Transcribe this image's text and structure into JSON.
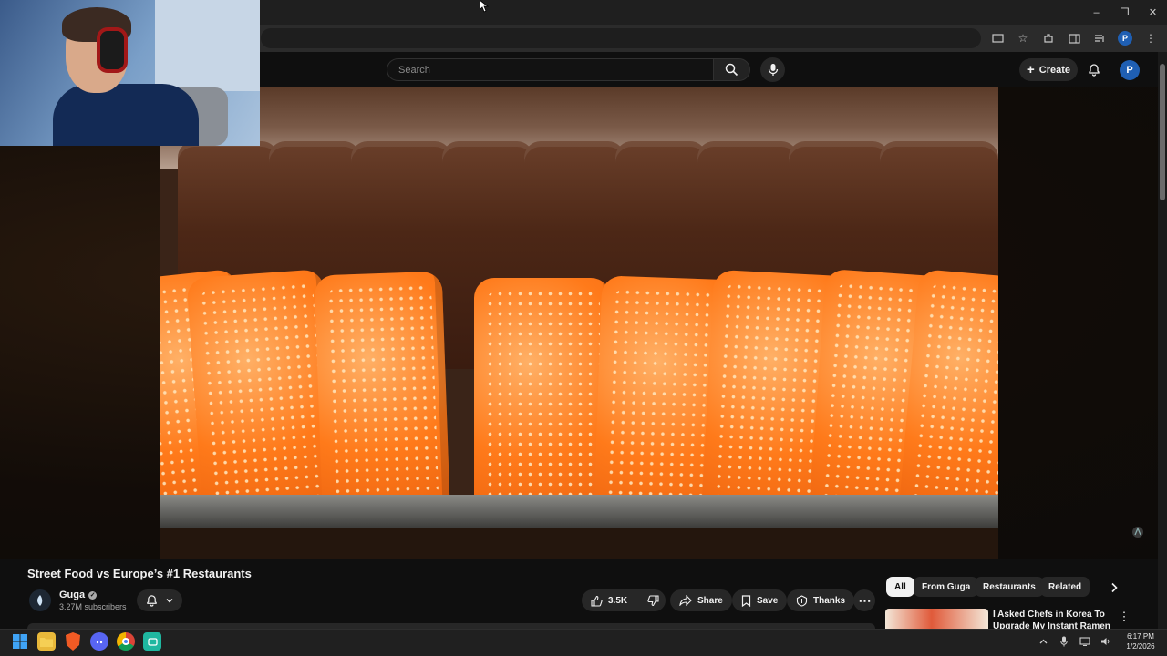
{
  "browser": {
    "window_controls": [
      "–",
      "❐",
      "✕"
    ],
    "toolbar_icons": [
      "cast-icon",
      "star-icon",
      "extensions-icon",
      "sidepanel-icon",
      "media-icon",
      "profile-icon",
      "menu-icon"
    ],
    "profile_initial": "P"
  },
  "masthead": {
    "search_placeholder": "Search",
    "create_label": "Create",
    "avatar_initial": "P"
  },
  "video": {
    "title": "Street Food vs Europe’s #1 Restaurants",
    "channel": {
      "name": "Guga",
      "subscribers": "3.27M subscribers"
    },
    "actions": {
      "like_count": "3.5K",
      "share_label": "Share",
      "save_label": "Save",
      "thanks_label": "Thanks"
    }
  },
  "chips": [
    "All",
    "From Guga",
    "Restaurants",
    "Related"
  ],
  "suggested": {
    "title": "I Asked Chefs in Korea To Upgrade My Instant Ramen"
  },
  "taskbar": {
    "time": "6:17 PM",
    "date": "1/2/2026"
  },
  "colors": {
    "background": "#0f0f0f",
    "chip_bg": "#272727",
    "accent_avatar": "#1f5fb3",
    "pastry_orange": "#ff7a1a"
  }
}
